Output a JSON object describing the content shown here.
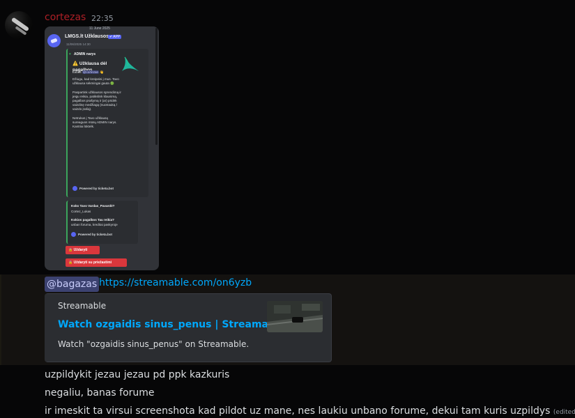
{
  "message": {
    "username": "cortezas",
    "time": "22:35",
    "username_color": "#ae1f26"
  },
  "attachment": {
    "date": "11 June 2025",
    "bot_name": "LMGS.lt Užklausos",
    "app_badge": "✔ APP",
    "bot_time": "11/06/2025 14:30",
    "embed": {
      "author": "ADMIN narys",
      "author_icon": "green-heart-icon",
      "title": "⚠️ Užklausa dėl pagalbos",
      "greeting": "Labas",
      "greeting_mention": "@cortezas",
      "greeting_emoji": "👋",
      "body": "Džiugu, kad kreipeisi į mus. Tavo užklausa sėkmingai gauta 🟢\n\nPaspartink užklausos sprendimą ir jeigu reikia, patikslink klausimą, pagalbos prašymą ir (ar) pridėk vaizdinę medžiagą (nuotrauką / vaizdo įrašą).\n\nNetrukus į Tavo užklausą sureaguos mūsų ADMIN narys. Kantriai lūktelk.",
      "footer": "Powered by ticketa.bot"
    },
    "form": {
      "q1": "Koks Tavo Vardas_Pavardė?",
      "a1": "Cortez_Lukas",
      "q2": "Kokios pagalbos Tau reikia?",
      "a2": "unban foruma, kreditai paskyroje",
      "footer": "Powered by ticketa.bot"
    },
    "buttons": [
      "🔒 Uždaryti",
      "🔒 Uždaryti su priežastimi"
    ]
  },
  "mention": {
    "tag": "@bagazas",
    "link": "https://streamable.com/on6yzb"
  },
  "link_embed": {
    "provider": "Streamable",
    "title": "Watch ozgaidis sinus_penus | Streamable",
    "description": "Watch \"ozgaidis sinus_penus\" on Streamable."
  },
  "messages": [
    {
      "text": "uzpildykit jezau jezau pd ppk kazkuris"
    },
    {
      "text": "negaliu, banas forume"
    },
    {
      "text": "ir imeskit ta virsui screenshota kad pildot uz mane, nes laukiu unbano forume, dekui tam kuris uzpildys",
      "edited": "(edited)"
    }
  ],
  "colors": {
    "link": "#00a8fc",
    "mention_bg": "#3c4270",
    "embed_accent": "#3ba55c",
    "button_red": "#da373c"
  }
}
